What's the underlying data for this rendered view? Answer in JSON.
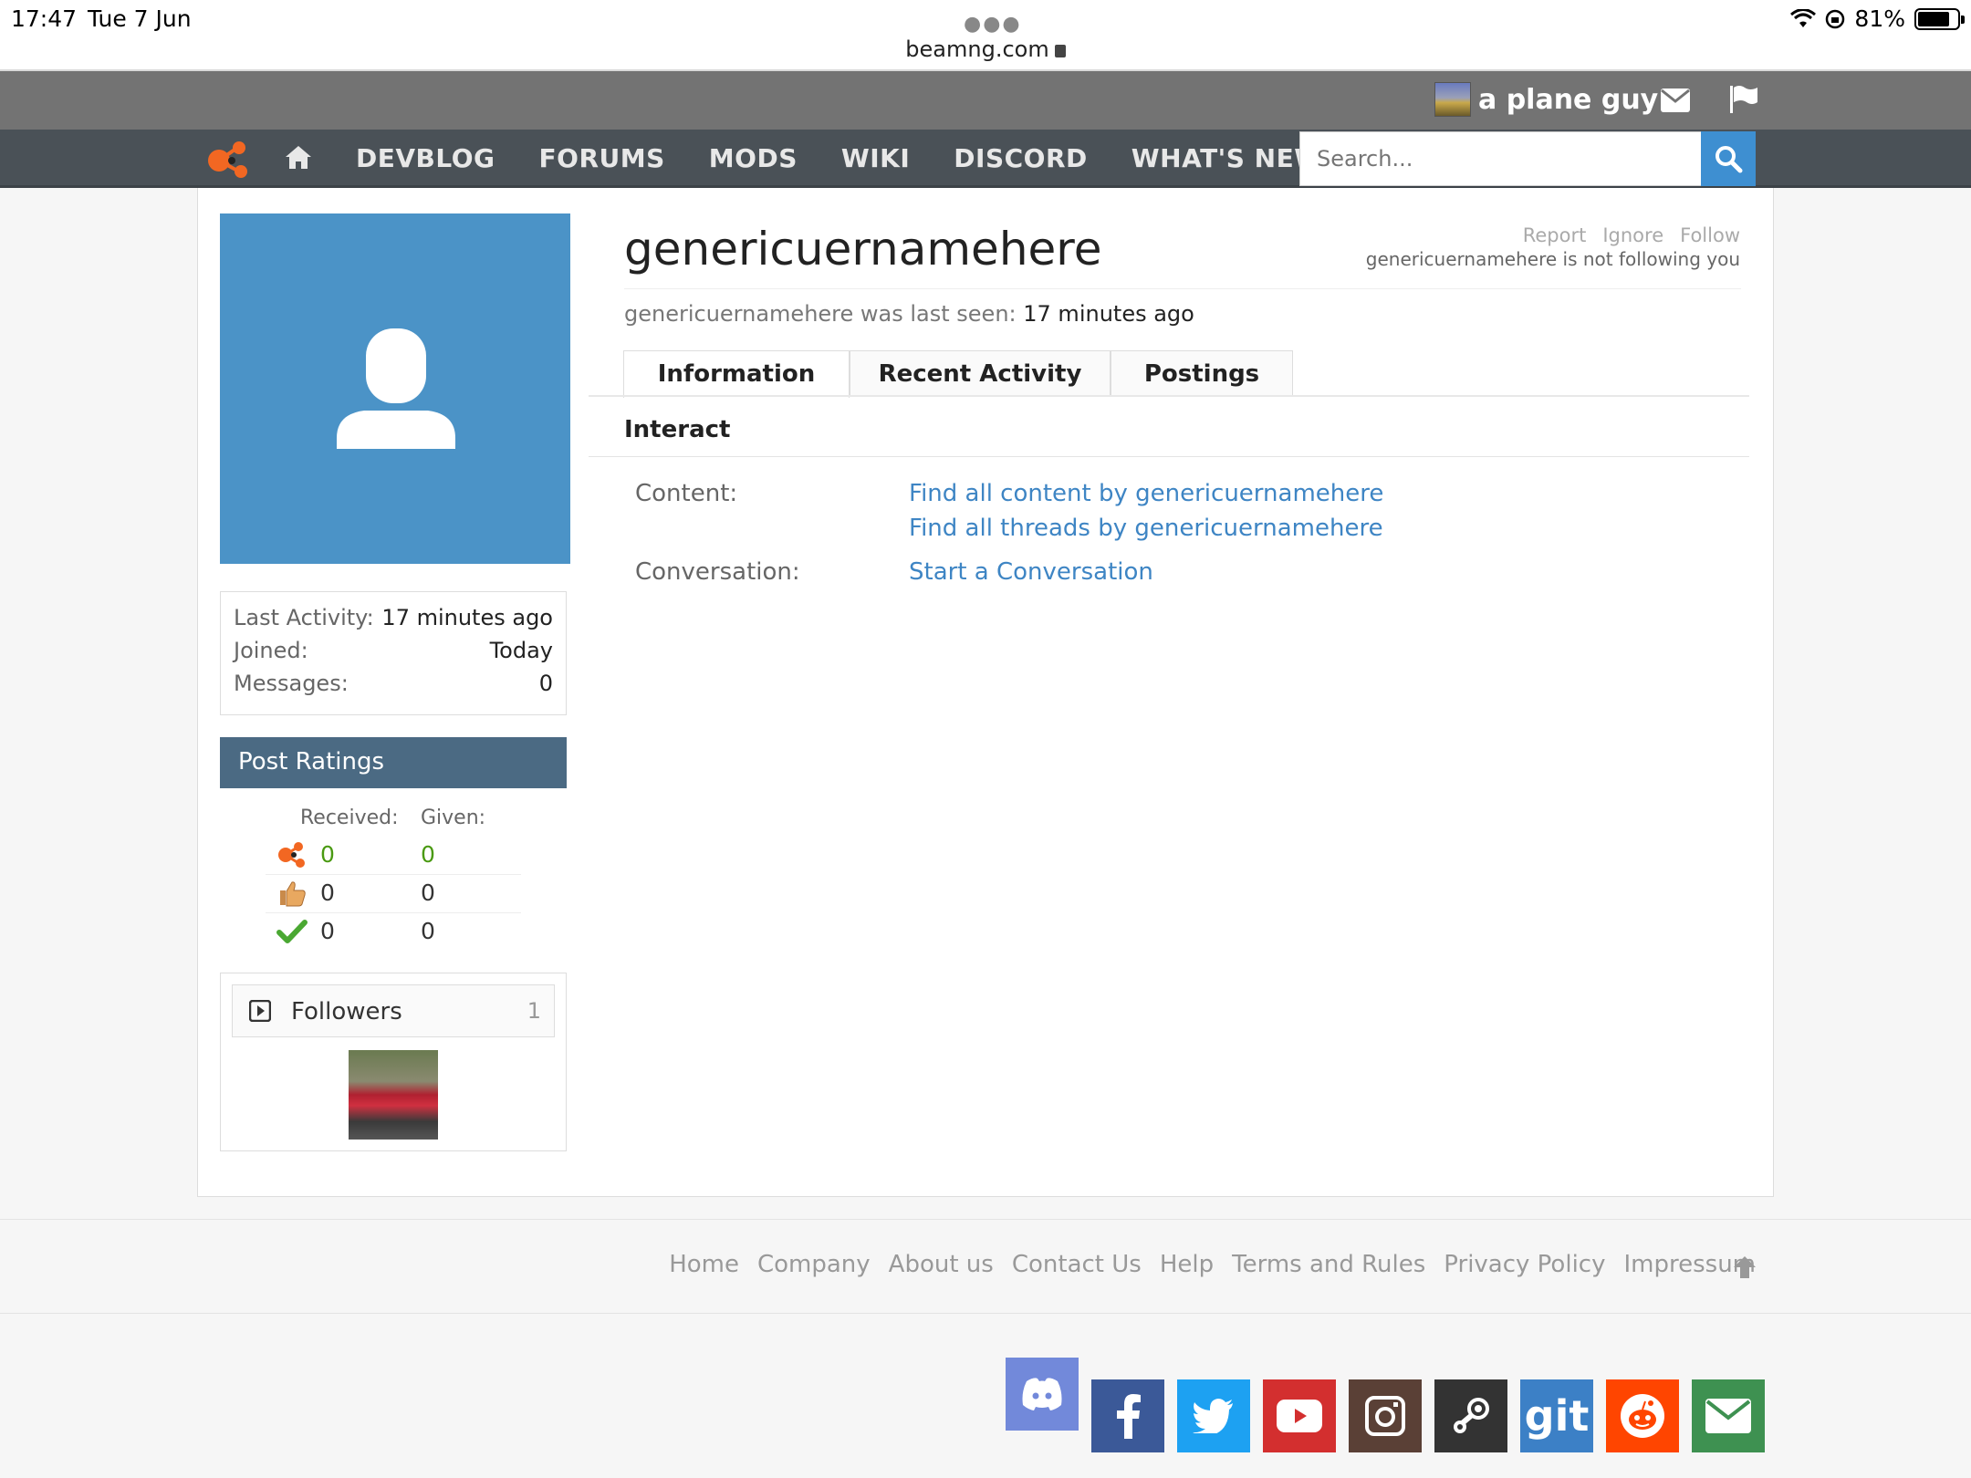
{
  "statusbar": {
    "time": "17:47",
    "date": "Tue 7 Jun",
    "url": "beamng.com",
    "battery": "81%",
    "battery_level": 0.81
  },
  "userbar": {
    "username": "a plane guy"
  },
  "nav": {
    "items": [
      "DEVBLOG",
      "FORUMS",
      "MODS",
      "WIKI",
      "DISCORD",
      "WHAT'S NEW?"
    ],
    "search_placeholder": "Search..."
  },
  "profile": {
    "username": "genericuernamehere",
    "actions": [
      "Report",
      "Ignore",
      "Follow"
    ],
    "following_note": "genericuernamehere is not following you",
    "last_seen_label": "genericuernamehere was last seen:",
    "last_seen_value": "17 minutes ago"
  },
  "stats": [
    {
      "label": "Last Activity:",
      "value": "17 minutes ago"
    },
    {
      "label": "Joined:",
      "value": "Today"
    },
    {
      "label": "Messages:",
      "value": "0"
    }
  ],
  "ratings": {
    "title": "Post Ratings",
    "received_label": "Received:",
    "given_label": "Given:",
    "rows": [
      {
        "icon": "beamng-logo-icon",
        "received": "0",
        "given": "0"
      },
      {
        "icon": "thumbs-up-icon",
        "received": "0",
        "given": "0"
      },
      {
        "icon": "checkmark-icon",
        "received": "0",
        "given": "0"
      }
    ]
  },
  "followers": {
    "title": "Followers",
    "count": "1"
  },
  "tabs": [
    "Information",
    "Recent Activity",
    "Postings"
  ],
  "interact": {
    "title": "Interact",
    "content_label": "Content:",
    "content_link_1": "Find all content by genericuernamehere",
    "content_link_2": "Find all threads by genericuernamehere",
    "conversation_label": "Conversation:",
    "conversation_link": "Start a Conversation"
  },
  "footer": {
    "links": [
      "Home",
      "Company",
      "About us",
      "Contact Us",
      "Help",
      "Terms and Rules",
      "Privacy Policy",
      "Impressum"
    ]
  },
  "social": {
    "git_label": "git",
    "colors": {
      "discord": "#7289da",
      "facebook": "#3b5998",
      "twitter": "#1da1f2",
      "youtube": "#d32f2f",
      "instagram": "#5a4036",
      "steam": "#333333",
      "git": "#3c80c6",
      "reddit": "#ff4500",
      "email": "#3e9151"
    }
  },
  "colors": {
    "nav_bg": "#4a5157",
    "userbar_bg": "#737373",
    "accent_blue": "#3e8fd1",
    "link": "#3e85c4",
    "avatar_bg": "#4b93c7",
    "ratings_head": "#4b6a83",
    "brand_orange": "#f26722"
  }
}
